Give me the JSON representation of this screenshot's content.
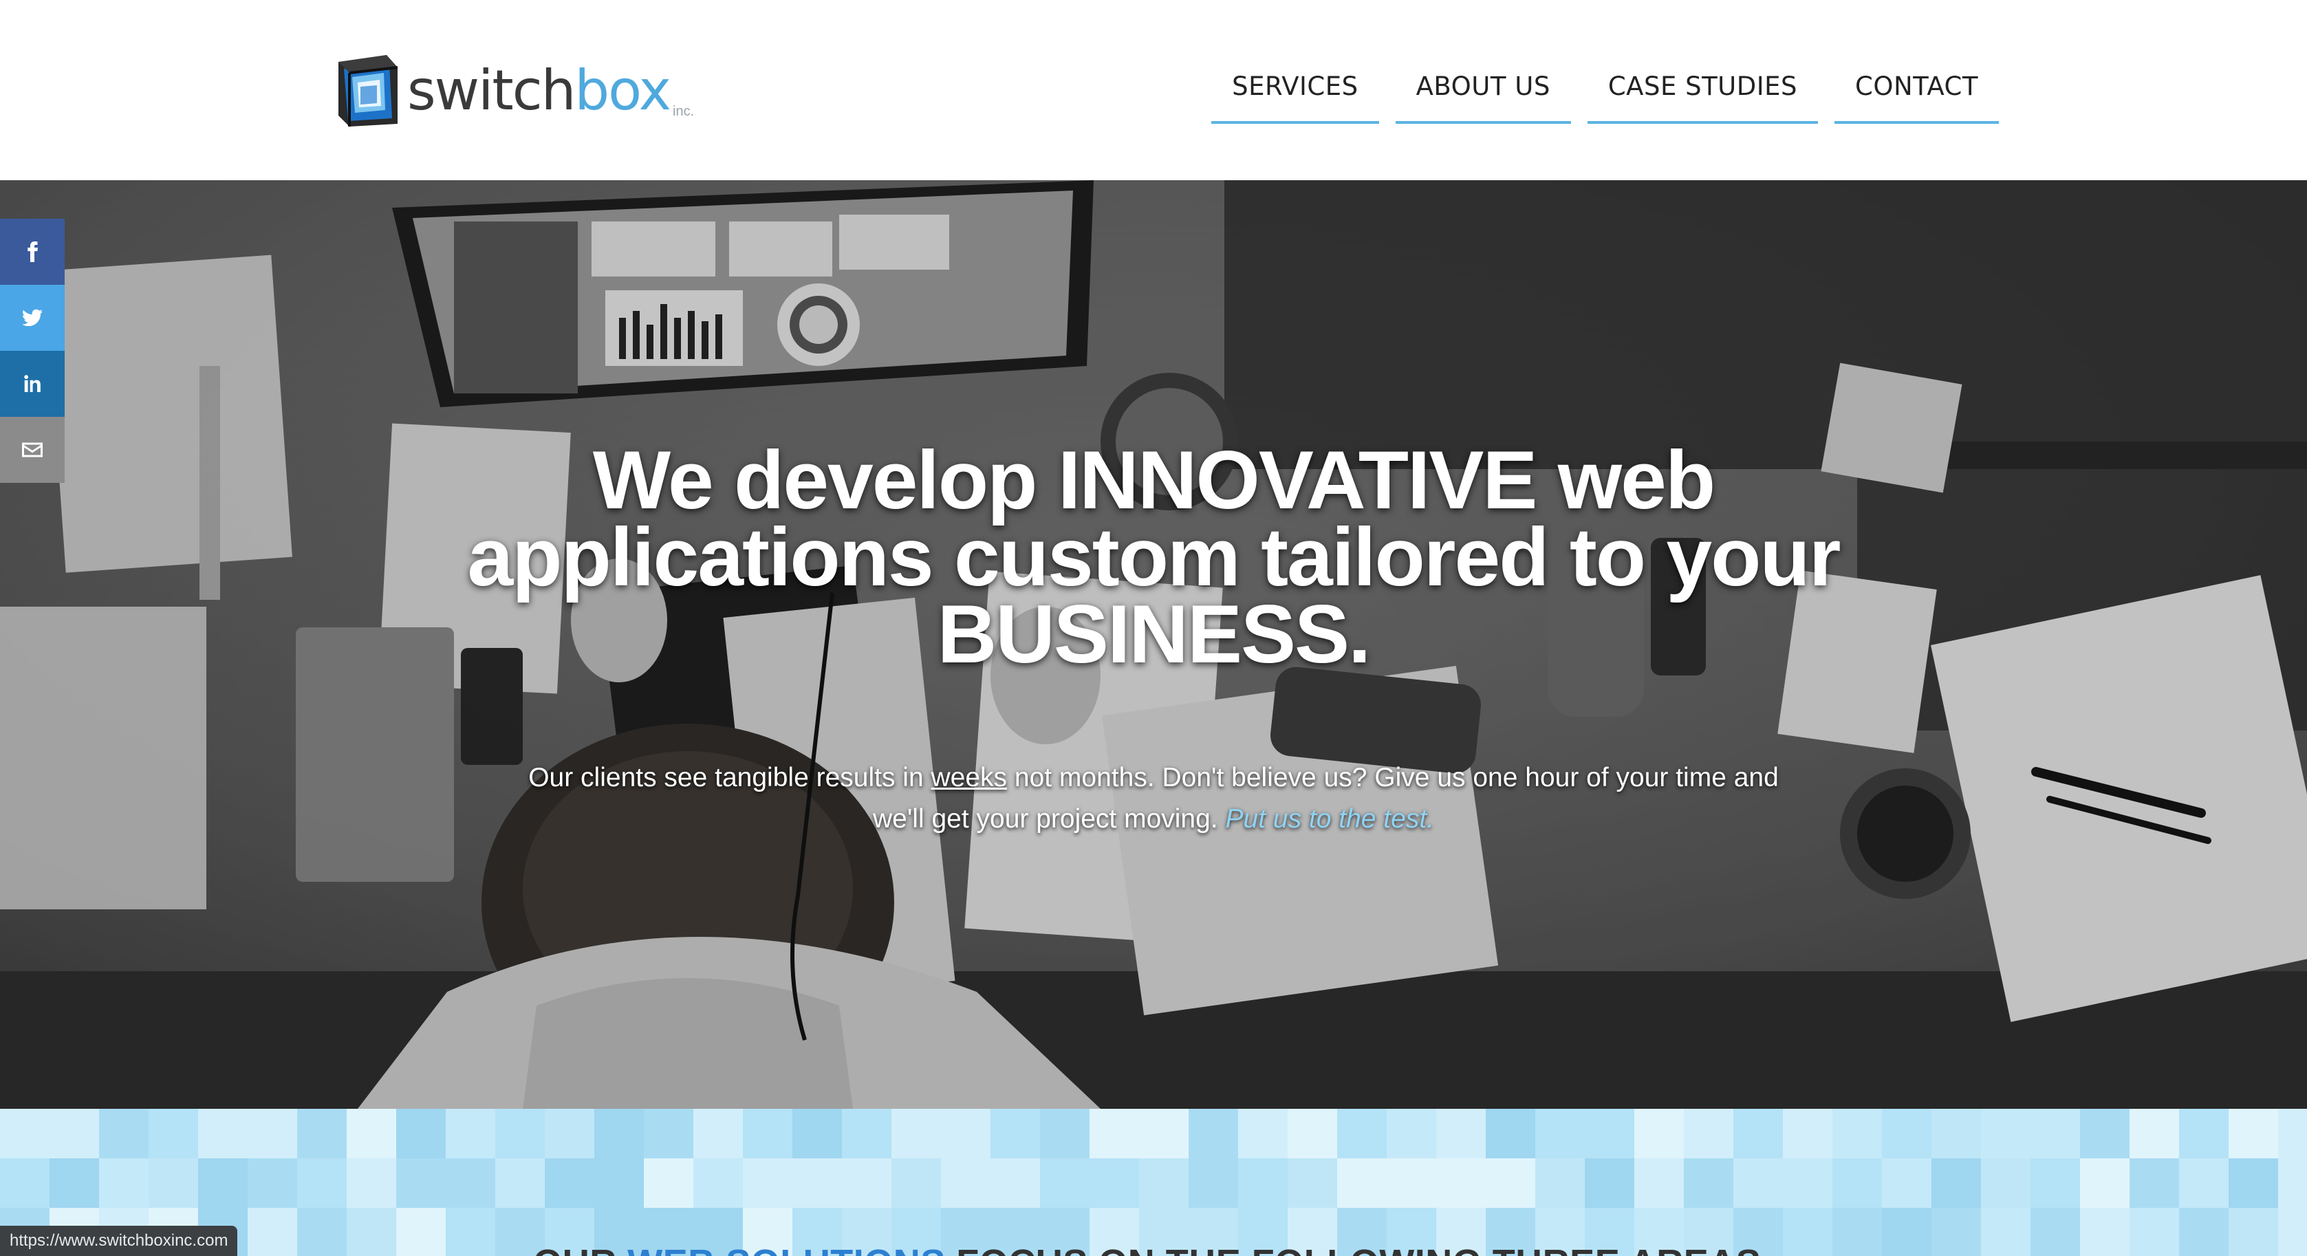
{
  "brand": {
    "name_part1": "switch",
    "name_part2": "box",
    "suffix": "inc.",
    "colors": {
      "accent": "#4fa9dd",
      "text": "#3a3a3a"
    }
  },
  "nav": {
    "items": [
      {
        "label": "SERVICES"
      },
      {
        "label": "ABOUT US"
      },
      {
        "label": "CASE STUDIES"
      },
      {
        "label": "CONTACT"
      }
    ],
    "underline_color": "#5bb4e4"
  },
  "hero": {
    "headline": {
      "part1": "We develop ",
      "bold1": "INNOVATIVE",
      "part2": " web applications custom tailored to your ",
      "bold2": "BUSINESS."
    },
    "subtext": {
      "part1": "Our clients see tangible results in ",
      "underlined": "weeks",
      "part2": " not months. Don't believe us? Give us one hour of your time and we'll get your project moving. ",
      "cta": "Put us to the test."
    },
    "image": "black-and-white overhead photo of a person working at a desk with a computer monitor showing a dashboard"
  },
  "social": {
    "buttons": [
      {
        "icon": "facebook-icon",
        "color": "#3b5a9b"
      },
      {
        "icon": "twitter-icon",
        "color": "#4aa6e6"
      },
      {
        "icon": "linkedin-icon",
        "color": "#1e6fa7"
      },
      {
        "icon": "email-icon",
        "color": "#8b8b8b"
      }
    ]
  },
  "solutions": {
    "heading_part1": "OUR ",
    "heading_highlight": "WEB SOLUTIONS",
    "heading_part2": " FOCUS ON THE FOLLOWING THREE AREAS:",
    "highlight_color": "#2d7fd1"
  },
  "status_bar": {
    "url": "https://www.switchboxinc.com"
  }
}
